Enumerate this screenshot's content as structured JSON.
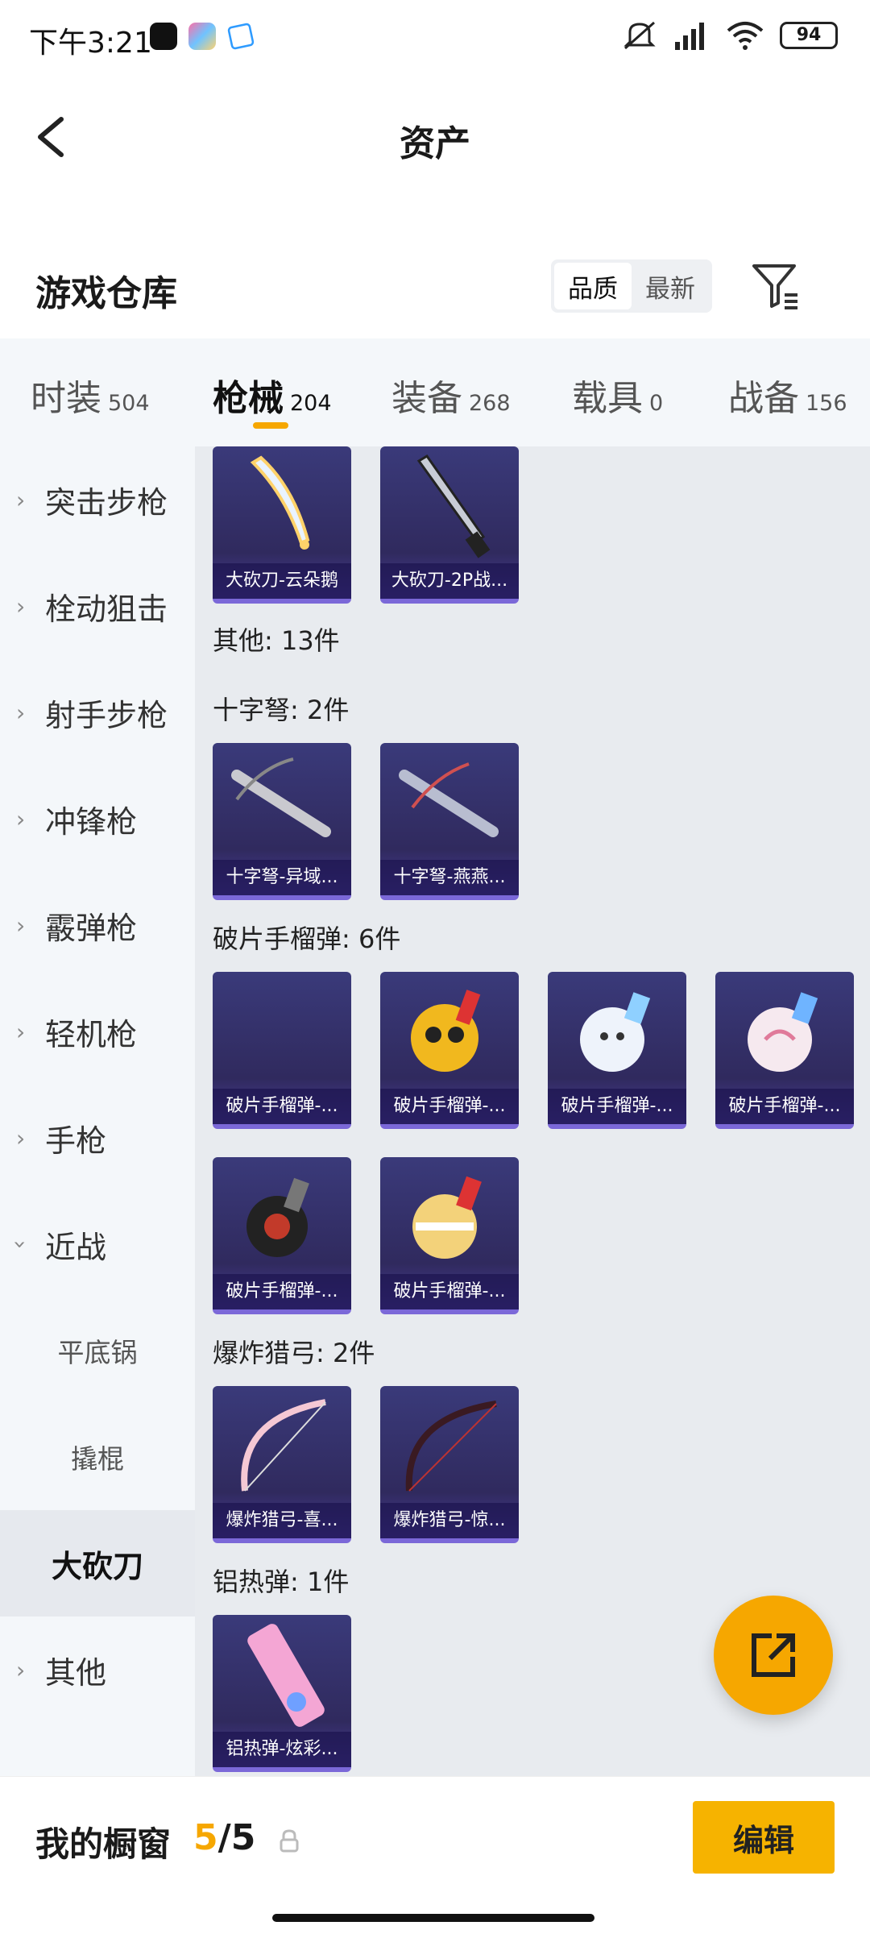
{
  "status": {
    "time": "下午3:21",
    "battery": "94"
  },
  "header": {
    "title": "资产"
  },
  "warehouse": {
    "title": "游戏仓库",
    "sort_quality": "品质",
    "sort_newest": "最新"
  },
  "tabs": [
    {
      "label": "时装",
      "count": "504"
    },
    {
      "label": "枪械",
      "count": "204"
    },
    {
      "label": "装备",
      "count": "268"
    },
    {
      "label": "载具",
      "count": "0"
    },
    {
      "label": "战备",
      "count": "156"
    }
  ],
  "sidebar": {
    "items": [
      "突击步枪",
      "栓动狙击",
      "射手步枪",
      "冲锋枪",
      "霰弹枪",
      "轻机枪",
      "手枪",
      "近战"
    ],
    "subitems": [
      "平底锅",
      "撬棍",
      "大砍刀"
    ],
    "other": "其他"
  },
  "grid": {
    "top_cards": [
      "大砍刀-云朵鹅",
      "大砍刀-2P战..."
    ],
    "other_total": "其他: 13件",
    "groups": [
      {
        "label": "十字弩: 2件",
        "cards": [
          "十字弩-异域...",
          "十字弩-燕燕..."
        ]
      },
      {
        "label": "破片手榴弹: 6件",
        "cards": [
          "破片手榴弹-...",
          "破片手榴弹-...",
          "破片手榴弹-...",
          "破片手榴弹-...",
          "破片手榴弹-...",
          "破片手榴弹-..."
        ]
      },
      {
        "label": "爆炸猎弓: 2件",
        "cards": [
          "爆炸猎弓-喜...",
          "爆炸猎弓-惊..."
        ]
      },
      {
        "label": "铝热弹: 1件",
        "cards": [
          "铝热弹-炫彩..."
        ]
      }
    ]
  },
  "bottom": {
    "showcase_label": "我的橱窗",
    "count_now": "5",
    "count_sep": "/",
    "count_max": "5",
    "edit": "编辑"
  },
  "colors": {
    "accent": "#f6a700",
    "card_bg": "#302a5e",
    "card_edge": "#7b68d8"
  }
}
